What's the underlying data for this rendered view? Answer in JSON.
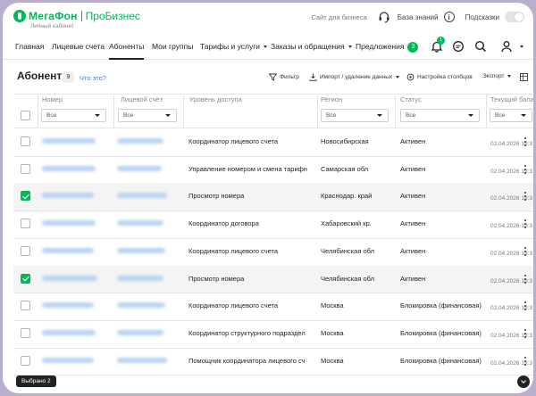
{
  "header": {
    "brand": "МегаФон",
    "product": "ПроБизнес",
    "subtitle": "Личный кабинет",
    "site_link": "Сайт для бизнеса",
    "kb_label": "База знаний",
    "hints_label": "Подсказки",
    "brand_color": "#00b956"
  },
  "nav": {
    "items": [
      {
        "label": "Главная"
      },
      {
        "label": "Лицевые счета"
      },
      {
        "label": "Абоненты"
      },
      {
        "label": "Мои группы"
      },
      {
        "label": "Тарифы и услуги"
      },
      {
        "label": "Заказы и обращения"
      },
      {
        "label": "Предложения"
      }
    ],
    "offers_badge": "3",
    "bell_badge": "1"
  },
  "toolbar": {
    "title": "Абоненты",
    "count": "9",
    "what_link": "Что это?",
    "filter": "Фильтр",
    "import": "Импорт / удаление данных",
    "columns": "Настройка столбцов",
    "export": "Экспорт"
  },
  "table": {
    "headers": [
      "Номер",
      "Лицевой счёт",
      "Уровень доступа",
      "Регион",
      "Статус",
      "Текущий бала"
    ],
    "filter_all": "Все",
    "rows": [
      {
        "checked": false,
        "access": "Координатор лицевого счета",
        "region": "Новосибирская",
        "status": "Активен",
        "date": "02.04.2026 19:3"
      },
      {
        "checked": false,
        "access": "Управление номером и смена тарифн",
        "region": "Самарская обл",
        "status": "Активен",
        "date": "02.04.2026 19:3"
      },
      {
        "checked": true,
        "access": "Просмотр номера",
        "region": "Краснодар. край",
        "status": "Активен",
        "date": "02.04.2026 19:3"
      },
      {
        "checked": false,
        "access": "Координатор договора",
        "region": "Хабаровский кр.",
        "status": "Активен",
        "date": "02.04.2026 19:3"
      },
      {
        "checked": false,
        "access": "Координатор лицевого счета",
        "region": "Челябинская обл",
        "status": "Активен",
        "date": "02.04.2026 19:3"
      },
      {
        "checked": true,
        "access": "Просмотр номера",
        "region": "Челябинская обл",
        "status": "Активен",
        "date": "02.04.2026 19:3"
      },
      {
        "checked": false,
        "access": "Координатор лицевого счета",
        "region": "Москва",
        "status": "Блокировка (финансовая)",
        "date": "02.04.2026 19:3"
      },
      {
        "checked": false,
        "access": "Координатор структурного подраздел",
        "region": "Москва",
        "status": "Блокировка (финансовая)",
        "date": "02.04.2026 19:3"
      },
      {
        "checked": false,
        "access": "Помощник координатора лицевого сч",
        "region": "Москва",
        "status": "Блокировка (финансовая)",
        "date": "02.04.2026 19:3"
      }
    ]
  },
  "footer": {
    "selected": "Выбрано 2"
  }
}
